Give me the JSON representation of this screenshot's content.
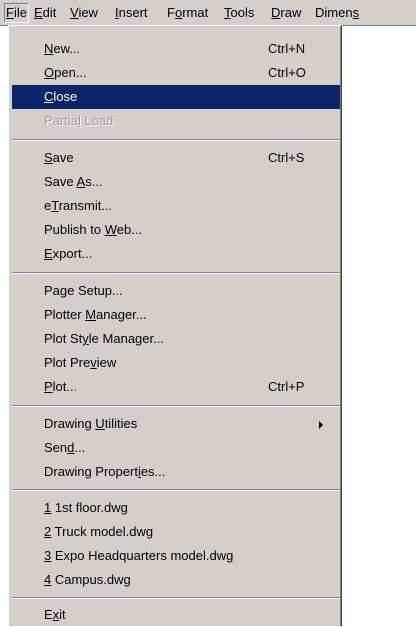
{
  "menubar": {
    "items": [
      {
        "pre": "",
        "ul": "F",
        "post": "ile"
      },
      {
        "pre": "",
        "ul": "E",
        "post": "dit"
      },
      {
        "pre": "",
        "ul": "V",
        "post": "iew"
      },
      {
        "pre": "",
        "ul": "I",
        "post": "nsert"
      },
      {
        "pre": "F",
        "ul": "o",
        "post": "rmat"
      },
      {
        "pre": "",
        "ul": "T",
        "post": "ools"
      },
      {
        "pre": "",
        "ul": "D",
        "post": "raw"
      },
      {
        "pre": "Dimen",
        "ul": "s",
        "post": ""
      }
    ]
  },
  "file_menu": {
    "items": [
      {
        "pre": "",
        "ul": "N",
        "post": "ew...",
        "shortcut": "Ctrl+N"
      },
      {
        "pre": "",
        "ul": "O",
        "post": "pen...",
        "shortcut": "Ctrl+O"
      },
      {
        "pre": "",
        "ul": "C",
        "post": "lose",
        "shortcut": ""
      },
      {
        "pre": "Partia",
        "ul": "l",
        "post": " Load",
        "shortcut": ""
      },
      {
        "pre": "",
        "ul": "S",
        "post": "ave",
        "shortcut": "Ctrl+S"
      },
      {
        "pre": "Save ",
        "ul": "A",
        "post": "s...",
        "shortcut": ""
      },
      {
        "pre": "e",
        "ul": "T",
        "post": "ransmit...",
        "shortcut": ""
      },
      {
        "pre": "Publish to ",
        "ul": "W",
        "post": "eb...",
        "shortcut": ""
      },
      {
        "pre": "",
        "ul": "E",
        "post": "xport...",
        "shortcut": ""
      },
      {
        "pre": "Pa",
        "ul": "g",
        "post": "e Setup...",
        "shortcut": ""
      },
      {
        "pre": "Plotter ",
        "ul": "M",
        "post": "anager...",
        "shortcut": ""
      },
      {
        "pre": "Plot St",
        "ul": "y",
        "post": "le Manager...",
        "shortcut": ""
      },
      {
        "pre": "Plot Pre",
        "ul": "v",
        "post": "iew",
        "shortcut": ""
      },
      {
        "pre": "",
        "ul": "P",
        "post": "lot...",
        "shortcut": "Ctrl+P"
      },
      {
        "pre": "Drawing ",
        "ul": "U",
        "post": "tilities",
        "shortcut": ""
      },
      {
        "pre": "Sen",
        "ul": "d",
        "post": "...",
        "shortcut": ""
      },
      {
        "pre": "Drawing Propert",
        "ul": "i",
        "post": "es...",
        "shortcut": ""
      },
      {
        "pre": "",
        "ul": "1",
        "post": " 1st floor.dwg",
        "shortcut": ""
      },
      {
        "pre": "",
        "ul": "2",
        "post": " Truck model.dwg",
        "shortcut": ""
      },
      {
        "pre": "",
        "ul": "3",
        "post": " Expo Headquarters model.dwg",
        "shortcut": ""
      },
      {
        "pre": "",
        "ul": "4",
        "post": " Campus.dwg",
        "shortcut": ""
      },
      {
        "pre": "E",
        "ul": "x",
        "post": "it",
        "shortcut": ""
      }
    ]
  }
}
